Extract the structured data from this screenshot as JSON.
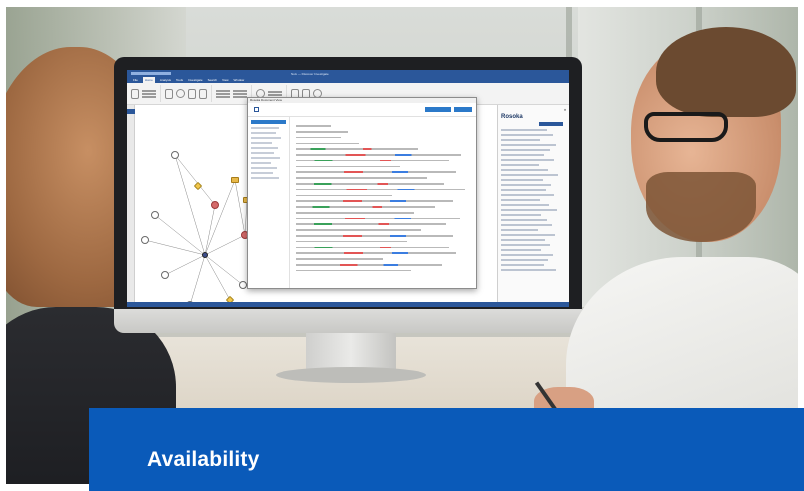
{
  "banner": {
    "title": "Availability"
  },
  "app": {
    "window_title": "Nuix — Discover Investigate",
    "menu": [
      "File",
      "Home",
      "Analysis",
      "Tools",
      "Investigate",
      "Search",
      "View",
      "Window"
    ],
    "active_menu": "Home"
  },
  "document_viewer": {
    "title": "Rosoka Document View"
  },
  "entity_panel": {
    "title": "Rosoka"
  },
  "colors": {
    "banner_blue": "#0a5ab9",
    "app_blue": "#2b579a"
  }
}
